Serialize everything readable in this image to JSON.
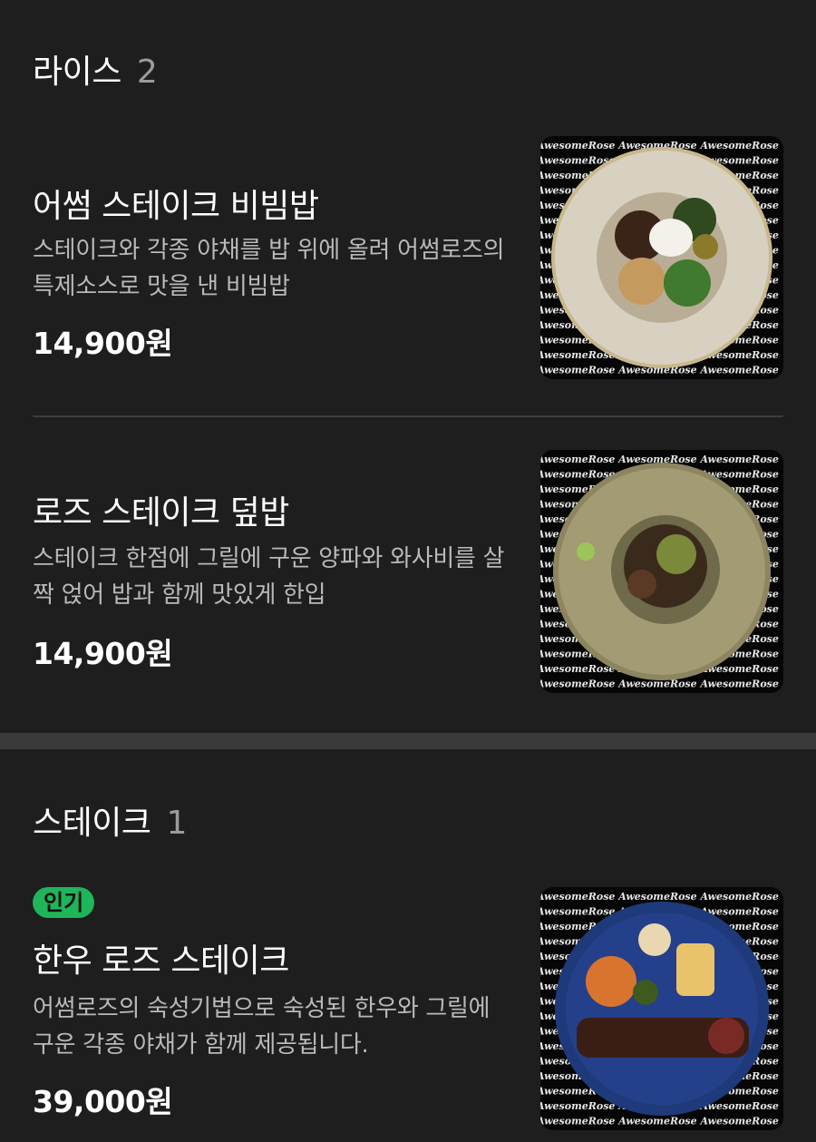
{
  "sections": [
    {
      "title": "라이스",
      "count": "2",
      "items": [
        {
          "name": "어썸 스테이크 비빔밥",
          "desc": "스테이크와 각종 야채를 밥 위에 올려 어썸로즈의 특제소스로 맛을 낸 비빔밥",
          "price": "14,900원",
          "image_icon": "bibimbap-photo"
        },
        {
          "name": "로즈 스테이크 덮밥",
          "desc": "스테이크 한점에 그릴에 구운 양파와 와사비를 살짝 얹어 밥과 함께 맛있게 한입",
          "price": "14,900원",
          "image_icon": "steak-rice-bowl-photo"
        }
      ]
    },
    {
      "title": "스테이크",
      "count": "1",
      "items": [
        {
          "badge": "인기",
          "name": "한우 로즈 스테이크",
          "desc": "어썸로즈의 숙성기법으로 숙성된 한우와 그릴에 구운 각종 야채가 함께 제공됩니다.",
          "price": "39,000원",
          "image_icon": "steak-plate-photo"
        }
      ]
    }
  ],
  "watermark_text": "AwesomeRose AwesomeRose AwesomeRose",
  "colors": {
    "background": "#1e1e1e",
    "section_separator": "#3a3a3a",
    "badge": "#1fb55a",
    "description": "#b9b9b9",
    "count": "#9b9b9b"
  }
}
